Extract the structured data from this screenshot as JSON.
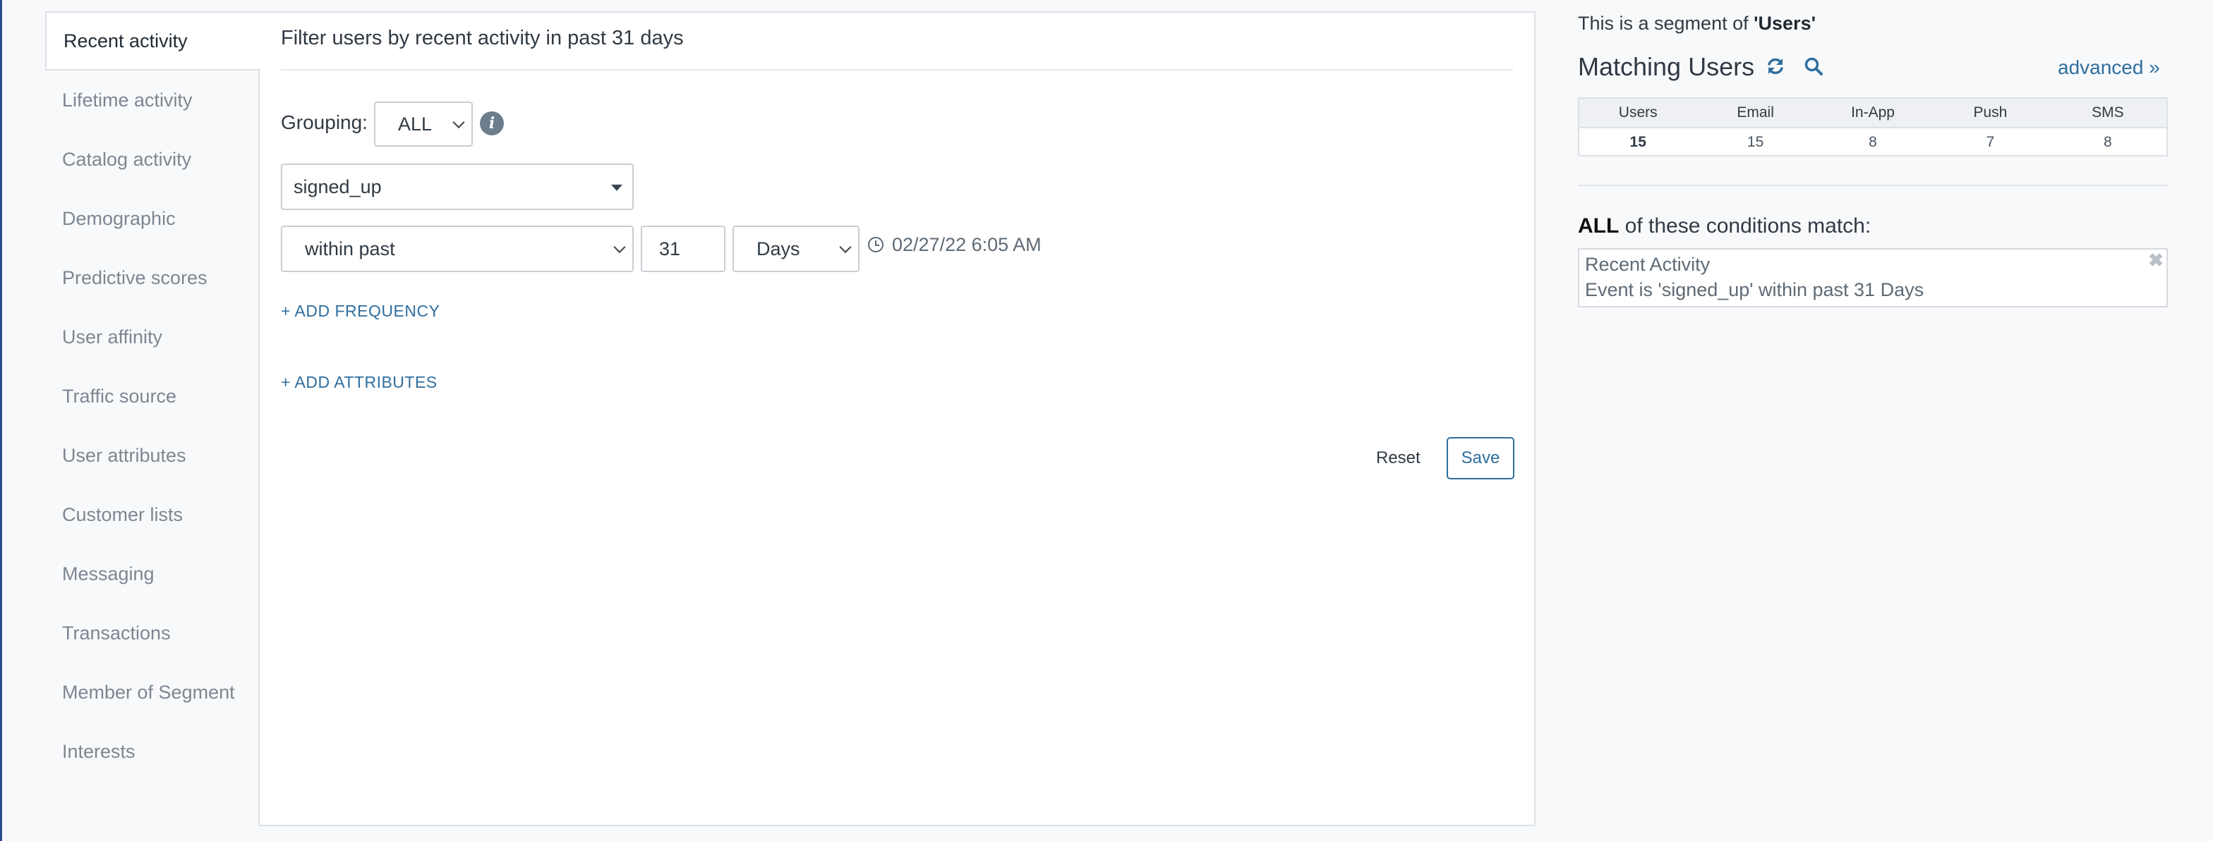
{
  "tabs": [
    {
      "label": "Recent activity",
      "active": true
    },
    {
      "label": "Lifetime activity"
    },
    {
      "label": "Catalog activity"
    },
    {
      "label": "Demographic"
    },
    {
      "label": "Predictive scores"
    },
    {
      "label": "User affinity"
    },
    {
      "label": "Traffic source"
    },
    {
      "label": "User attributes"
    },
    {
      "label": "Customer lists"
    },
    {
      "label": "Messaging"
    },
    {
      "label": "Transactions"
    },
    {
      "label": "Member of Segment"
    },
    {
      "label": "Interests"
    }
  ],
  "filter": {
    "title": "Filter users by recent activity in past 31 days",
    "grouping_label": "Grouping:",
    "grouping_value": "ALL",
    "event_value": "signed_up",
    "time_operator": "within past",
    "time_amount": "31",
    "time_unit": "Days",
    "date_text": "02/27/22 6:05 AM",
    "add_frequency": "+ ADD FREQUENCY",
    "add_attributes": "+ ADD ATTRIBUTES",
    "reset_label": "Reset",
    "save_label": "Save"
  },
  "summary": {
    "segment_note_prefix": "This is a segment of ",
    "segment_name": "'Users'",
    "matching_title": "Matching Users",
    "advanced_label": "advanced »",
    "stats_headers": [
      "Users",
      "Email",
      "In-App",
      "Push",
      "SMS"
    ],
    "stats_values": [
      "15",
      "15",
      "8",
      "7",
      "8"
    ],
    "conditions_bold": "ALL",
    "conditions_rest": " of these conditions match:",
    "condition_name": "Recent Activity",
    "condition_desc": "Event is 'signed_up' within past 31 Days",
    "close_glyph": "✖"
  },
  "icons": {
    "info": "info-icon",
    "clock": "clock-icon",
    "refresh": "refresh-icon",
    "search": "search-icon",
    "close": "close-icon"
  },
  "colors": {
    "accent": "#2f6e9e",
    "border": "#dde1e6",
    "text": "#303a44",
    "muted": "#7c8791"
  }
}
